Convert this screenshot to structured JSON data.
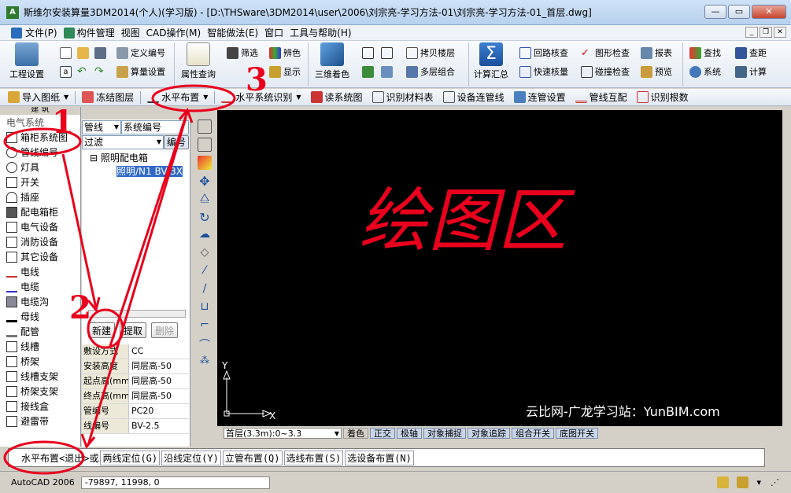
{
  "window": {
    "title": "斯维尔安装算量3DM2014(个人)(学习版) - [D:\\THSware\\3DM2014\\user\\2006\\刘宗亮-学习方法-01\\刘宗亮-学习方法-01_首层.dwg]",
    "app_icon": "A"
  },
  "menu": {
    "items": [
      "文件(P)",
      "构件管理",
      "视图",
      "CAD操作(M)",
      "智能做法(E)",
      "窗口",
      "工具与帮助(H)"
    ]
  },
  "ribbon": {
    "project_settings": "工程设置",
    "define_code": "定义编号",
    "calc_settings": "算量设置",
    "attr_query": "属性查询",
    "filter": "筛选",
    "color_id": "辨色",
    "show": "显示",
    "color3d": "三维着色",
    "copy_floor": "拷贝楼层",
    "multi_floor": "多层组合",
    "calc_summary": "计算汇总",
    "loop_check": "回路核查",
    "graph_check": "图形检查",
    "report": "报表",
    "fast_check": "快速核量",
    "collision_check": "碰撞检查",
    "preview": "预览",
    "find": "查找",
    "distance": "查距",
    "system": "系统",
    "compute": "计算"
  },
  "toolbar": {
    "items": [
      "导入图纸",
      "冻结图层",
      "水平布置",
      "水平系统识别",
      "读系统图",
      "识别材料表",
      "设备连管线",
      "连管设置",
      "管线互配",
      "识别根数"
    ]
  },
  "left_panel": {
    "header": "建 筑",
    "items": [
      "电气系统",
      "箱柜系统图",
      "管线编号",
      "灯具",
      "开关",
      "插座",
      "配电箱柜",
      "电气设备",
      "消防设备",
      "其它设备",
      "电线",
      "电缆",
      "电缆沟",
      "母线",
      "配管",
      "线槽",
      "桥架",
      "线槽支架",
      "桥架支架",
      "接线盒",
      "避雷带"
    ]
  },
  "mid_panel": {
    "type_combo": "管线",
    "code_combo": "系统编号",
    "filter_label": "过滤",
    "edit_button": "编号",
    "tree_root": "照明配电箱",
    "tree_child": "照明/N1 BV-3X",
    "new_button": "新建",
    "extract_button": "提取",
    "delete_button": "删除",
    "props": [
      {
        "k": "敷设方式",
        "v": "CC"
      },
      {
        "k": "安装高度",
        "v": "同层高-50"
      },
      {
        "k": "起点高(mm",
        "v": "同层高-50"
      },
      {
        "k": "终点高(mm",
        "v": "同层高-50"
      },
      {
        "k": "管编号",
        "v": "PC20"
      },
      {
        "k": "线编号",
        "v": "BV-2.5"
      }
    ]
  },
  "canvas": {
    "handwritten_label": "绘图区",
    "watermark": "云比网-广龙学习站：YunBIM.com",
    "axis_y": "Y",
    "axis_x": "X"
  },
  "canvas_status": {
    "floor_combo": "首层(3.3m):0~3.3",
    "buttons": [
      "着色",
      "正交",
      "极轴",
      "对象捕捉",
      "对象追踪",
      "组合开关",
      "底图开关"
    ]
  },
  "command_line": {
    "prompt": "水平布置<退出>或",
    "options": [
      "两线定位(G)",
      "沿线定位(Y)",
      "立管布置(Q)",
      "选线布置(S)",
      "选设备布置(N)"
    ]
  },
  "statusbar": {
    "version": "AutoCAD 2006",
    "coords": "-79897,  11998, 0"
  },
  "annotations": {
    "n1": "1",
    "n2": "2",
    "n3": "3"
  },
  "colors": {
    "annotation_red": "#e8001c",
    "canvas_bg": "#000000"
  }
}
